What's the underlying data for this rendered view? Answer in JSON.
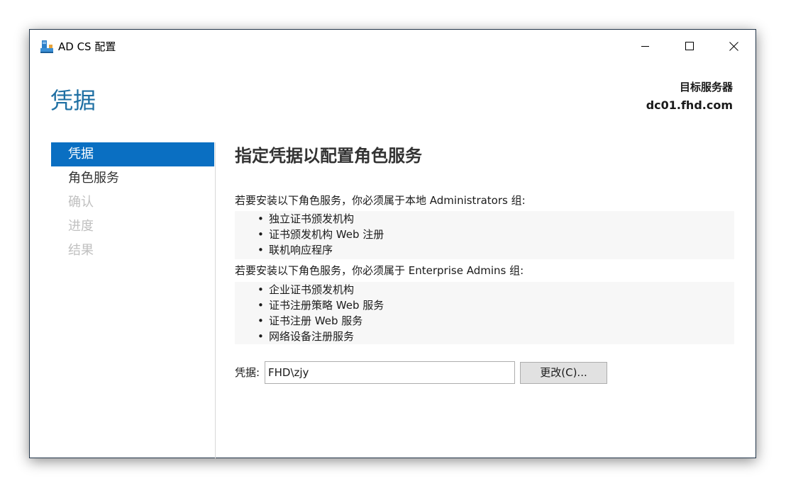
{
  "window": {
    "title": "AD CS 配置",
    "minimize_icon": "minimize-icon",
    "maximize_icon": "maximize-icon",
    "close_icon": "close-icon"
  },
  "header": {
    "page_title": "凭据",
    "target_label": "目标服务器",
    "target_server": "dc01.fhd.com"
  },
  "sidebar": {
    "items": [
      {
        "label": "凭据",
        "state": "active"
      },
      {
        "label": "角色服务",
        "state": "enabled"
      },
      {
        "label": "确认",
        "state": "disabled"
      },
      {
        "label": "进度",
        "state": "disabled"
      },
      {
        "label": "结果",
        "state": "disabled"
      }
    ]
  },
  "main": {
    "title": "指定凭据以配置角色服务",
    "local_admin_text": "若要安装以下角色服务，你必须属于本地 Administrators 组:",
    "local_admin_roles": [
      "独立证书颁发机构",
      "证书颁发机构 Web 注册",
      "联机响应程序"
    ],
    "enterprise_admin_text": "若要安装以下角色服务，你必须属于 Enterprise Admins 组:",
    "enterprise_admin_roles": [
      "企业证书颁发机构",
      "证书注册策略 Web 服务",
      "证书注册 Web 服务",
      "网络设备注册服务"
    ],
    "credentials_label": "凭据:",
    "credentials_value": "FHD\\zjy",
    "change_button": "更改(C)..."
  },
  "colors": {
    "accent": "#0a6fc2",
    "title_blue": "#1e6fa3",
    "disabled_text": "#c0c0c0"
  }
}
